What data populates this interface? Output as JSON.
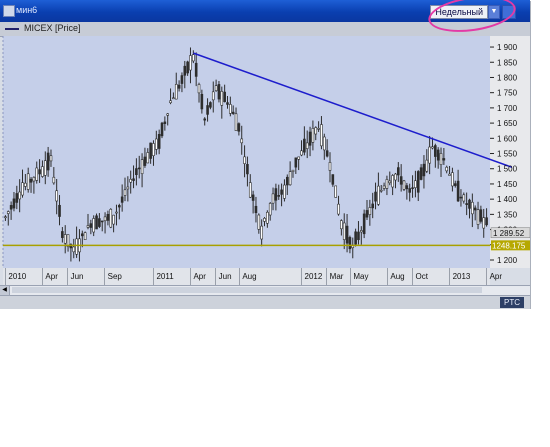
{
  "window": {
    "title": "мин6",
    "period_label": "Недельный"
  },
  "legend": {
    "series_name": "MICEX [Price]"
  },
  "status": {
    "tab_label": "PTC"
  },
  "colors": {
    "plot_bg": "#c5cfe9",
    "candle": "#2c2c2c",
    "trend_line": "#1d1dcc",
    "support_line": "#a8a000",
    "price_axis_bg": "#e8e9ec",
    "current_price_box": "#d9d9d9",
    "support_price_box": "#b6a800",
    "highlight": "#e33aa6"
  },
  "chart_data": {
    "type": "candlestick",
    "title": "",
    "series": "MICEX [Price]",
    "x_ticks": [
      "2010",
      "Apr",
      "Jun",
      "Sep",
      "2011",
      "Apr",
      "Jun",
      "Aug",
      "2012",
      "Mar",
      "May",
      "Aug",
      "Oct",
      "2013",
      "Apr"
    ],
    "y_ticks": [
      "1 900",
      "1 850",
      "1 800",
      "1 750",
      "1 700",
      "1 650",
      "1 600",
      "1 550",
      "1 500",
      "1 450",
      "1 400",
      "1 350",
      "1 300",
      "1 250",
      "1 200"
    ],
    "ylim": [
      1200,
      1910
    ],
    "price_path": [
      [
        0,
        1340
      ],
      [
        6,
        1440
      ],
      [
        10,
        1470
      ],
      [
        16,
        1530
      ],
      [
        20,
        1290
      ],
      [
        24,
        1230
      ],
      [
        30,
        1320
      ],
      [
        38,
        1340
      ],
      [
        46,
        1490
      ],
      [
        54,
        1590
      ],
      [
        58,
        1720
      ],
      [
        62,
        1790
      ],
      [
        66,
        1870
      ],
      [
        70,
        1660
      ],
      [
        74,
        1760
      ],
      [
        78,
        1720
      ],
      [
        82,
        1640
      ],
      [
        86,
        1440
      ],
      [
        90,
        1300
      ],
      [
        94,
        1400
      ],
      [
        98,
        1430
      ],
      [
        102,
        1520
      ],
      [
        106,
        1580
      ],
      [
        110,
        1640
      ],
      [
        114,
        1520
      ],
      [
        118,
        1320
      ],
      [
        122,
        1240
      ],
      [
        126,
        1320
      ],
      [
        130,
        1400
      ],
      [
        134,
        1460
      ],
      [
        138,
        1480
      ],
      [
        142,
        1420
      ],
      [
        146,
        1470
      ],
      [
        150,
        1570
      ],
      [
        154,
        1530
      ],
      [
        158,
        1440
      ],
      [
        162,
        1385
      ],
      [
        166,
        1350
      ],
      [
        169,
        1320
      ]
    ],
    "last_price": "1 289.52",
    "support_level": "1248.175",
    "support_value": 1248.175,
    "trendline": {
      "from": [
        2011.27,
        1880
      ],
      "to": [
        2013.42,
        1505
      ]
    },
    "grid": false
  }
}
